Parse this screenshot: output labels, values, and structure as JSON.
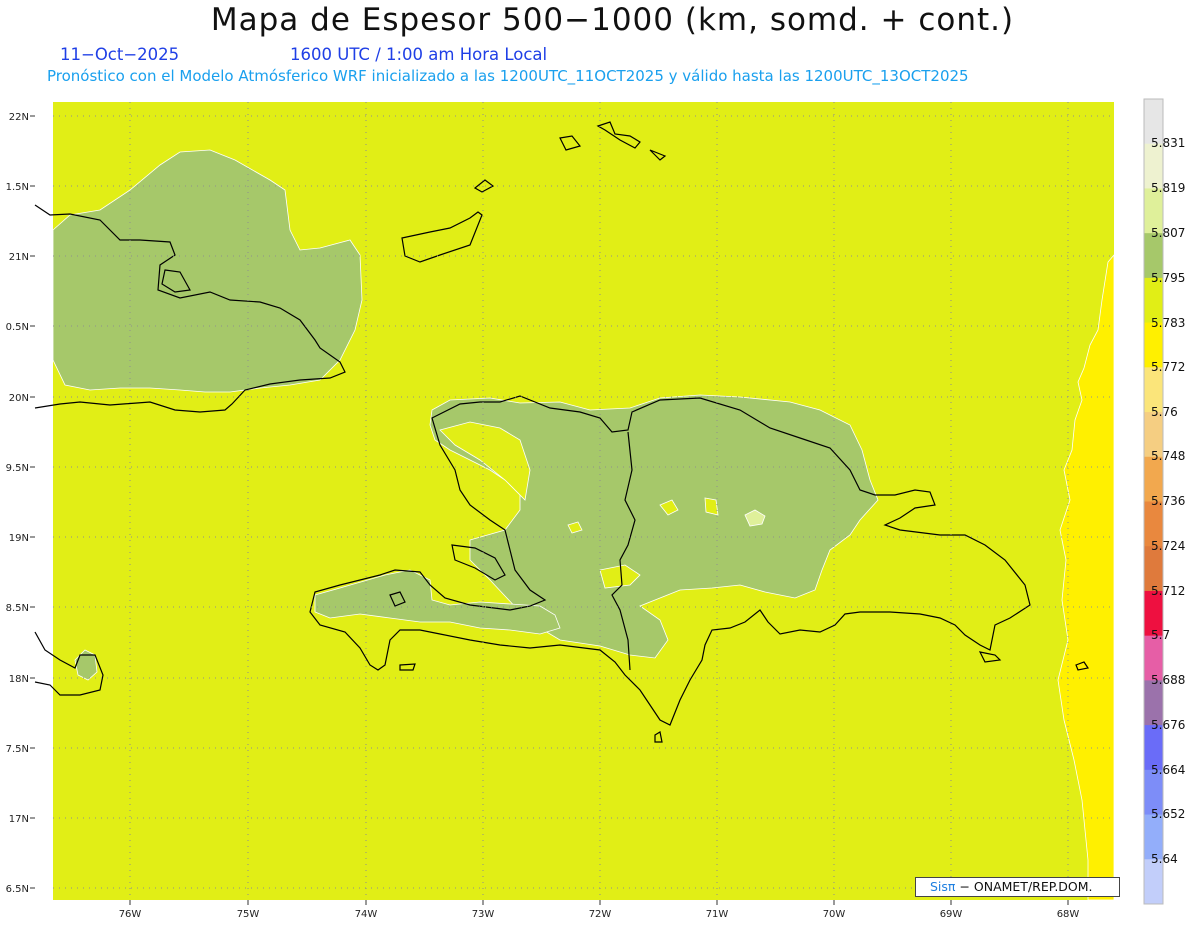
{
  "header": {
    "title": "Mapa de Espesor 500−1000 (km, somd. + cont.)",
    "date": "11−Oct−2025",
    "time": "1600 UTC / 1:00 am Hora Local",
    "description": "Pronóstico con el Modelo Atmósferico WRF inicializado a las 1200UTC_11OCT2025 y válido hasta las  1200UTC_13OCT2025"
  },
  "axes": {
    "lat_labels": [
      "22N",
      "1.5N",
      "21N",
      "0.5N",
      "20N",
      "9.5N",
      "19N",
      "8.5N",
      "18N",
      "7.5N",
      "17N",
      "6.5N"
    ],
    "lon_labels": [
      "76W",
      "75W",
      "74W",
      "73W",
      "72W",
      "71W",
      "70W",
      "69W",
      "68W"
    ]
  },
  "colorbar": {
    "labels": [
      "5.831",
      "5.819",
      "5.807",
      "5.795",
      "5.783",
      "5.772",
      "5.76",
      "5.748",
      "5.736",
      "5.724",
      "5.712",
      "5.7",
      "5.688",
      "5.676",
      "5.664",
      "5.652",
      "5.64"
    ],
    "colors": [
      "#e6e6e6",
      "#eef2d0",
      "#dff09a",
      "#a6c86a",
      "#e1ee16",
      "#fff000",
      "#fbe57a",
      "#f5ce82",
      "#f2a84e",
      "#e9883e",
      "#df7a3c",
      "#ee1040",
      "#e65ea6",
      "#9b72ab",
      "#6a6cf8",
      "#7d8df8",
      "#93aefa",
      "#c2cefa"
    ]
  },
  "colors": {
    "background_field": "#e1ee16",
    "anomaly_field": "#a6c86a",
    "high_field": "#fff000",
    "light_patch": "#dff09a",
    "subtitle_blue": "#1f3fe6",
    "subtitle_cyan": "#1aa0ee"
  },
  "credit": {
    "logo": "Sisπ",
    "text": "− ONAMET/REP.DOM."
  }
}
